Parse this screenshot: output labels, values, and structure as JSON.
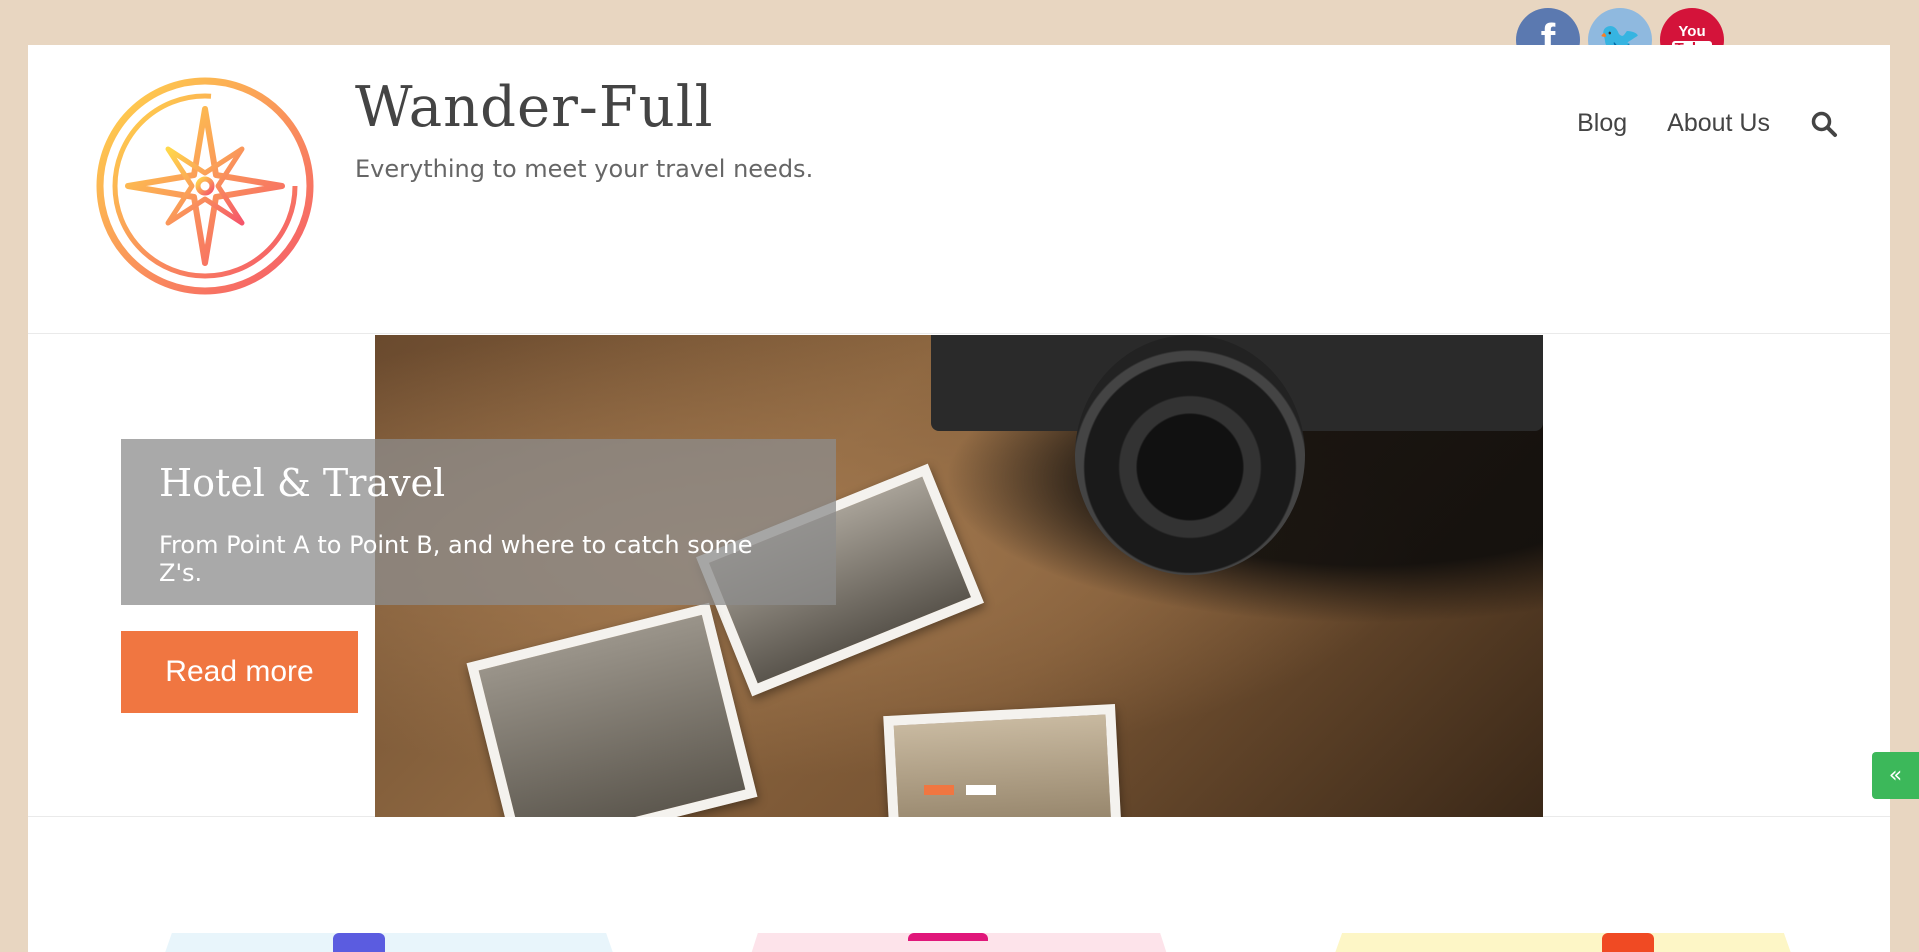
{
  "social": {
    "facebook_glyph": "f",
    "twitter_glyph": "🐦",
    "youtube_line1": "You",
    "youtube_line2": "Tube"
  },
  "header": {
    "title": "Wander-Full",
    "tagline": "Everything to meet your travel needs."
  },
  "nav": {
    "items": [
      {
        "label": "Blog"
      },
      {
        "label": "About Us"
      }
    ]
  },
  "slider": {
    "caption_title": "Hotel & Travel",
    "caption_text": "From Point A to Point B, and where to catch some Z's.",
    "button_label": "Read more",
    "active_slide": 1,
    "slide_count": 2
  },
  "side_toggle": {
    "glyph": "«"
  },
  "colors": {
    "accent": "#f07641",
    "background": "#e8d6c1",
    "toggle": "#3cb85a"
  }
}
